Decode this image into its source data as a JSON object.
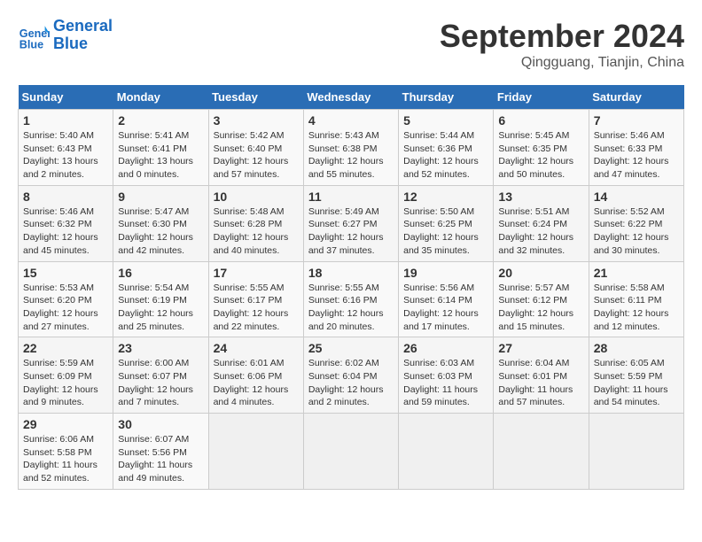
{
  "header": {
    "logo_line1": "General",
    "logo_line2": "Blue",
    "month": "September 2024",
    "location": "Qingguang, Tianjin, China"
  },
  "days_of_week": [
    "Sunday",
    "Monday",
    "Tuesday",
    "Wednesday",
    "Thursday",
    "Friday",
    "Saturday"
  ],
  "weeks": [
    [
      {
        "day": 1,
        "info": "Sunrise: 5:40 AM\nSunset: 6:43 PM\nDaylight: 13 hours\nand 2 minutes."
      },
      {
        "day": 2,
        "info": "Sunrise: 5:41 AM\nSunset: 6:41 PM\nDaylight: 13 hours\nand 0 minutes."
      },
      {
        "day": 3,
        "info": "Sunrise: 5:42 AM\nSunset: 6:40 PM\nDaylight: 12 hours\nand 57 minutes."
      },
      {
        "day": 4,
        "info": "Sunrise: 5:43 AM\nSunset: 6:38 PM\nDaylight: 12 hours\nand 55 minutes."
      },
      {
        "day": 5,
        "info": "Sunrise: 5:44 AM\nSunset: 6:36 PM\nDaylight: 12 hours\nand 52 minutes."
      },
      {
        "day": 6,
        "info": "Sunrise: 5:45 AM\nSunset: 6:35 PM\nDaylight: 12 hours\nand 50 minutes."
      },
      {
        "day": 7,
        "info": "Sunrise: 5:46 AM\nSunset: 6:33 PM\nDaylight: 12 hours\nand 47 minutes."
      }
    ],
    [
      {
        "day": 8,
        "info": "Sunrise: 5:46 AM\nSunset: 6:32 PM\nDaylight: 12 hours\nand 45 minutes."
      },
      {
        "day": 9,
        "info": "Sunrise: 5:47 AM\nSunset: 6:30 PM\nDaylight: 12 hours\nand 42 minutes."
      },
      {
        "day": 10,
        "info": "Sunrise: 5:48 AM\nSunset: 6:28 PM\nDaylight: 12 hours\nand 40 minutes."
      },
      {
        "day": 11,
        "info": "Sunrise: 5:49 AM\nSunset: 6:27 PM\nDaylight: 12 hours\nand 37 minutes."
      },
      {
        "day": 12,
        "info": "Sunrise: 5:50 AM\nSunset: 6:25 PM\nDaylight: 12 hours\nand 35 minutes."
      },
      {
        "day": 13,
        "info": "Sunrise: 5:51 AM\nSunset: 6:24 PM\nDaylight: 12 hours\nand 32 minutes."
      },
      {
        "day": 14,
        "info": "Sunrise: 5:52 AM\nSunset: 6:22 PM\nDaylight: 12 hours\nand 30 minutes."
      }
    ],
    [
      {
        "day": 15,
        "info": "Sunrise: 5:53 AM\nSunset: 6:20 PM\nDaylight: 12 hours\nand 27 minutes."
      },
      {
        "day": 16,
        "info": "Sunrise: 5:54 AM\nSunset: 6:19 PM\nDaylight: 12 hours\nand 25 minutes."
      },
      {
        "day": 17,
        "info": "Sunrise: 5:55 AM\nSunset: 6:17 PM\nDaylight: 12 hours\nand 22 minutes."
      },
      {
        "day": 18,
        "info": "Sunrise: 5:55 AM\nSunset: 6:16 PM\nDaylight: 12 hours\nand 20 minutes."
      },
      {
        "day": 19,
        "info": "Sunrise: 5:56 AM\nSunset: 6:14 PM\nDaylight: 12 hours\nand 17 minutes."
      },
      {
        "day": 20,
        "info": "Sunrise: 5:57 AM\nSunset: 6:12 PM\nDaylight: 12 hours\nand 15 minutes."
      },
      {
        "day": 21,
        "info": "Sunrise: 5:58 AM\nSunset: 6:11 PM\nDaylight: 12 hours\nand 12 minutes."
      }
    ],
    [
      {
        "day": 22,
        "info": "Sunrise: 5:59 AM\nSunset: 6:09 PM\nDaylight: 12 hours\nand 9 minutes."
      },
      {
        "day": 23,
        "info": "Sunrise: 6:00 AM\nSunset: 6:07 PM\nDaylight: 12 hours\nand 7 minutes."
      },
      {
        "day": 24,
        "info": "Sunrise: 6:01 AM\nSunset: 6:06 PM\nDaylight: 12 hours\nand 4 minutes."
      },
      {
        "day": 25,
        "info": "Sunrise: 6:02 AM\nSunset: 6:04 PM\nDaylight: 12 hours\nand 2 minutes."
      },
      {
        "day": 26,
        "info": "Sunrise: 6:03 AM\nSunset: 6:03 PM\nDaylight: 11 hours\nand 59 minutes."
      },
      {
        "day": 27,
        "info": "Sunrise: 6:04 AM\nSunset: 6:01 PM\nDaylight: 11 hours\nand 57 minutes."
      },
      {
        "day": 28,
        "info": "Sunrise: 6:05 AM\nSunset: 5:59 PM\nDaylight: 11 hours\nand 54 minutes."
      }
    ],
    [
      {
        "day": 29,
        "info": "Sunrise: 6:06 AM\nSunset: 5:58 PM\nDaylight: 11 hours\nand 52 minutes."
      },
      {
        "day": 30,
        "info": "Sunrise: 6:07 AM\nSunset: 5:56 PM\nDaylight: 11 hours\nand 49 minutes."
      },
      null,
      null,
      null,
      null,
      null
    ]
  ]
}
